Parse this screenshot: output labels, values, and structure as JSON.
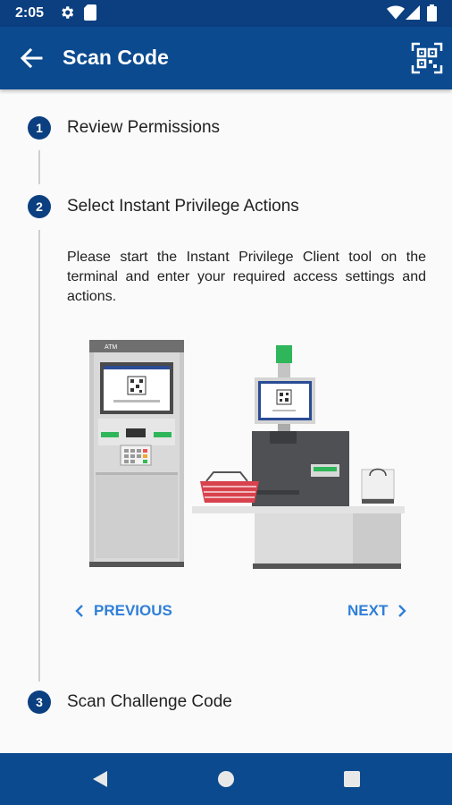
{
  "status_bar": {
    "time": "2:05"
  },
  "app_bar": {
    "title": "Scan Code"
  },
  "steps": [
    {
      "number": "1",
      "label": "Review Permissions"
    },
    {
      "number": "2",
      "label": "Select Instant Privilege Actions",
      "body": "Please start the Instant Privilege Client tool on the terminal and enter your required access settings and actions."
    },
    {
      "number": "3",
      "label": "Scan Challenge Code"
    }
  ],
  "illustration": {
    "atm_label": "ATM"
  },
  "navigation": {
    "previous_label": "PREVIOUS",
    "next_label": "NEXT"
  },
  "colors": {
    "primary": "#0b4a8f",
    "accent": "#2f7fd8",
    "status_bar": "#0b3f80"
  },
  "icons": [
    "settings-gear-icon",
    "sim-card-icon",
    "wifi-icon",
    "signal-icon",
    "battery-icon",
    "back-arrow-icon",
    "qr-code-icon",
    "back-triangle-icon",
    "home-circle-icon",
    "recents-square-icon"
  ]
}
